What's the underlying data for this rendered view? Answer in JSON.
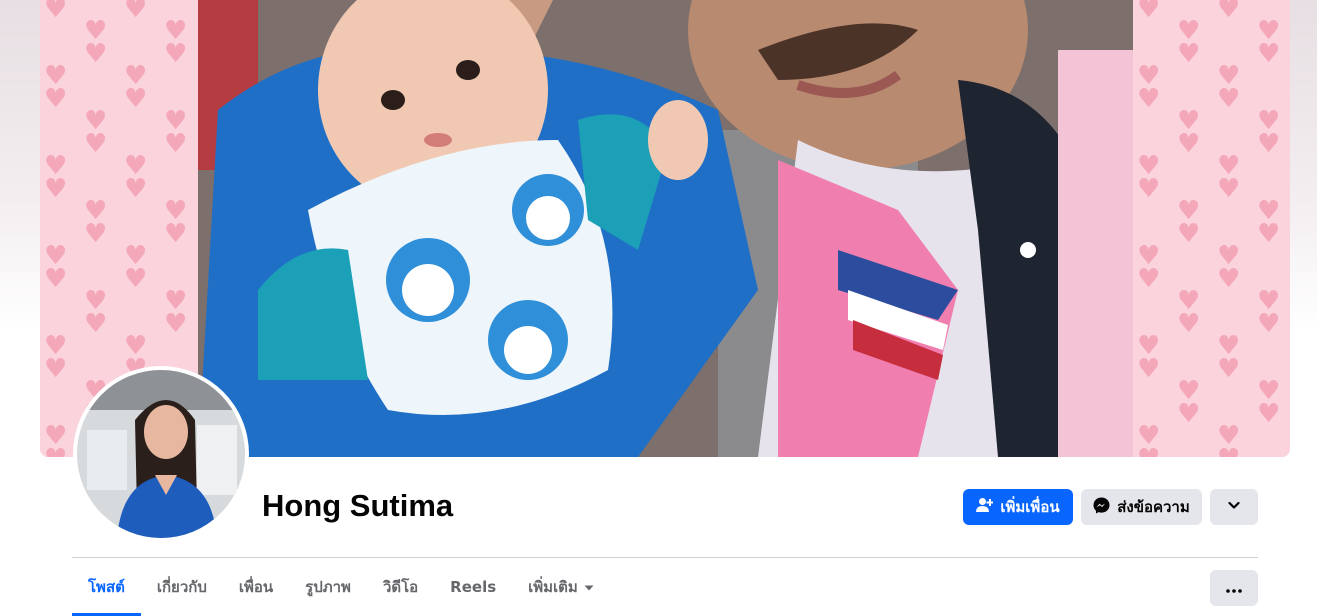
{
  "profile": {
    "name": "Hong Sutima"
  },
  "actions": {
    "add_friend_label": "เพิ่มเพื่อน",
    "add_friend_icon": "person-plus-icon",
    "message_label": "ส่งข้อความ",
    "message_icon": "messenger-icon",
    "more_icon": "chevron-down-icon"
  },
  "tabs": [
    {
      "label": "โพสต์",
      "active": true
    },
    {
      "label": "เกี่ยวกับ",
      "active": false
    },
    {
      "label": "เพื่อน",
      "active": false
    },
    {
      "label": "รูปภาพ",
      "active": false
    },
    {
      "label": "วิดีโอ",
      "active": false
    },
    {
      "label": "Reels",
      "active": false
    },
    {
      "label": "เพิ่มเติม",
      "active": false,
      "icon": "caret-down-icon"
    }
  ],
  "tab_actions_icon": "more-dots-icon",
  "colors": {
    "accent": "#0866ff",
    "button_gray": "#e4e6eb",
    "cover_pink": "#fbd3dc",
    "heart": "#f4a7b9"
  }
}
